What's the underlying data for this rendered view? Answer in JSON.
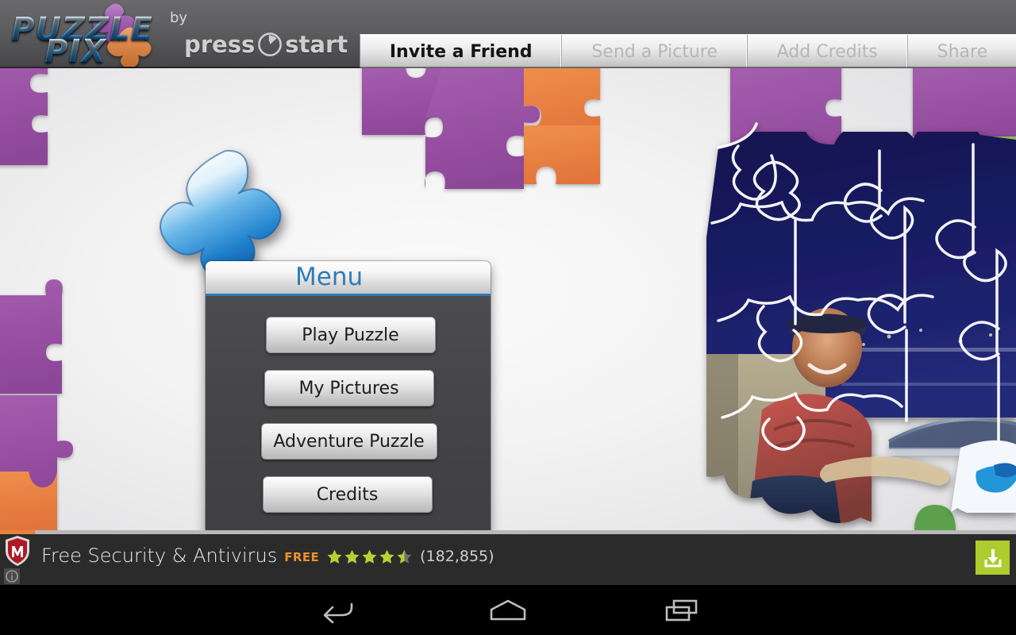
{
  "app": {
    "logo_word_1": "PUZZLE",
    "logo_word_2": "PIX",
    "by_label": "by",
    "publisher_pre": "press",
    "publisher_post": "start"
  },
  "tabs": [
    {
      "label": "Invite a Friend",
      "state": "active"
    },
    {
      "label": "Send a Picture",
      "state": "disabled"
    },
    {
      "label": "Add Credits",
      "state": "disabled"
    },
    {
      "label": "Share",
      "state": "disabled"
    }
  ],
  "menu": {
    "title": "Menu",
    "title_color": "#2e7cb6",
    "accent_color": "#2a79b4",
    "buttons": [
      {
        "label": "Play Puzzle"
      },
      {
        "label": "My Pictures"
      },
      {
        "label": "Adventure Puzzle"
      },
      {
        "label": "Credits"
      }
    ]
  },
  "ad": {
    "icon_name": "mcafee-shield-icon",
    "title": "Free Security & Antivirus",
    "price_badge": "FREE",
    "price_badge_color": "#f0902c",
    "rating": 4.5,
    "rating_max": 5,
    "star_color": "#b6d133",
    "review_count": "(182,855)",
    "download_icon": "download-icon",
    "download_button_color": "#adcd2e",
    "info_icon": "info-icon"
  },
  "navbar": {
    "back": "back-button",
    "home": "home-button",
    "recent": "recent-apps-button"
  },
  "background": {
    "colors": {
      "purple": "#9b54a5",
      "purple_dark": "#8a4694",
      "orange": "#ec8440",
      "green": "#8cc152",
      "navy": "#191d64",
      "blue_piece_light": "#eef8ff",
      "blue_piece_mid": "#3e9fdd",
      "blue_piece_dark": "#1160a8"
    }
  }
}
